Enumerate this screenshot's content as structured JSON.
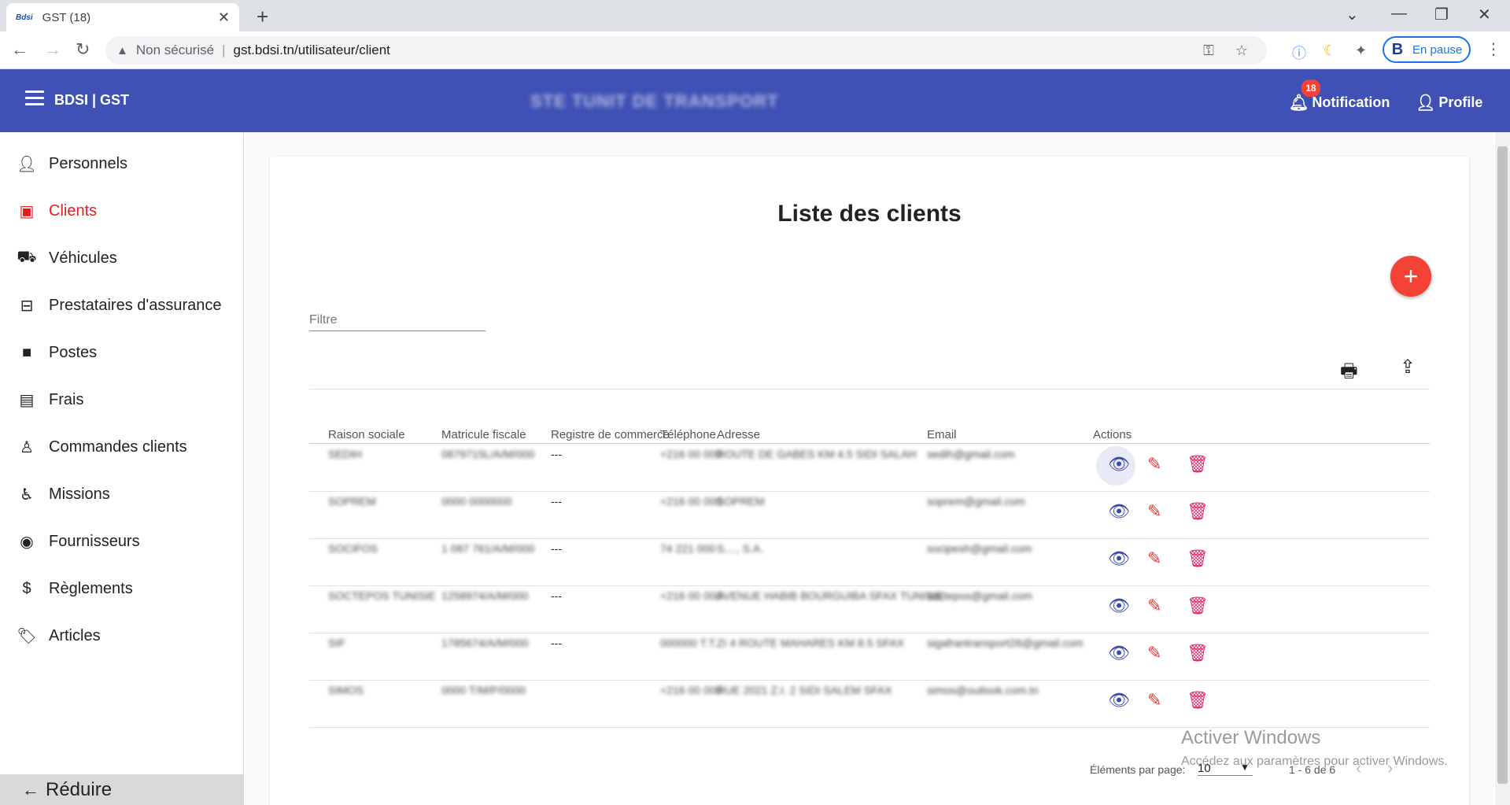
{
  "browser": {
    "tab_title": "GST (18)",
    "tab_favicon": "Bdsi",
    "security_label": "Non sécurisé",
    "url": "gst.bdsi.tn/utilisateur/client",
    "profile_initial": "B",
    "profile_status": "En pause"
  },
  "header": {
    "brand": "BDSI | GST",
    "company": "STE TUNIT DE TRANSPORT",
    "notification_count": "18",
    "notification_label": "Notification",
    "profile_label": "Profile",
    "color": "#3f51b5"
  },
  "sidebar": {
    "items": [
      {
        "label": "Personnels",
        "icon": "person-icon"
      },
      {
        "label": "Clients",
        "icon": "contact-badge-icon",
        "active": true
      },
      {
        "label": "Véhicules",
        "icon": "truck-icon"
      },
      {
        "label": "Prestataires d'assurance",
        "icon": "briefcase-outline-icon"
      },
      {
        "label": "Postes",
        "icon": "briefcase-icon"
      },
      {
        "label": "Frais",
        "icon": "money-icon"
      },
      {
        "label": "Commandes clients",
        "icon": "person-outline-icon"
      },
      {
        "label": "Missions",
        "icon": "seat-icon"
      },
      {
        "label": "Fournisseurs",
        "icon": "account-circle-icon"
      },
      {
        "label": "Règlements",
        "icon": "dollar-icon"
      },
      {
        "label": "Articles",
        "icon": "tag-icon"
      }
    ],
    "reduce_label": "Réduire",
    "active_color": "#e51c23"
  },
  "main": {
    "title": "Liste des clients",
    "filter_placeholder": "Filtre",
    "table": {
      "columns": [
        "Raison sociale",
        "Matricule fiscale",
        "Registre de commerce",
        "Téléphone",
        "Adresse",
        "Email",
        "Actions"
      ],
      "rows": [
        {
          "raison": "SEDIH",
          "matricule": "0879715L/A/M/000",
          "registre": "---",
          "telephone": "+216 00 000",
          "adresse": "ROUTE DE GABES KM 4.5 SIDI SALAH",
          "email": "sedih@gmail.com"
        },
        {
          "raison": "SOPREM",
          "matricule": "0000 0000000",
          "registre": "---",
          "telephone": "+216 00 000",
          "adresse": "SOPREM",
          "email": "soprem@gmail.com"
        },
        {
          "raison": "SOCIFOS",
          "matricule": "1 087 761/A/M/000",
          "registre": "---",
          "telephone": "74 221 000",
          "adresse": "S...., S.A.",
          "email": "socipesh@gmail.com"
        },
        {
          "raison": "SOCTEPOS TUNISIE",
          "matricule": "1258974/A/M/000",
          "registre": "---",
          "telephone": "+216 00 000",
          "adresse": "AVENUE HABIB BOURGUIBA SFAX TUNISIE",
          "email": "soctepos@gmail.com"
        },
        {
          "raison": "SIF",
          "matricule": "1785674/A/M/000",
          "registre": "---",
          "telephone": "000000 T.T.",
          "adresse": "ZI 4 ROUTE MAHARES KM 8.5 SFAX",
          "email": "sigafrantransport26@gmail.com"
        },
        {
          "raison": "SIMOS",
          "matricule": "0000 T/M/P/0000",
          "registre": "",
          "telephone": "+216 00 000",
          "adresse": "RUE 2021 Z.I. 2 SIDI SALEM SFAX",
          "email": "simos@outlook.com.tn"
        }
      ]
    },
    "paginator": {
      "label": "Éléments par page:",
      "page_size": "10",
      "range": "1 - 6 de 6"
    },
    "watermark": {
      "title": "Activer Windows",
      "subtitle": "Accédez aux paramètres pour activer Windows."
    }
  }
}
